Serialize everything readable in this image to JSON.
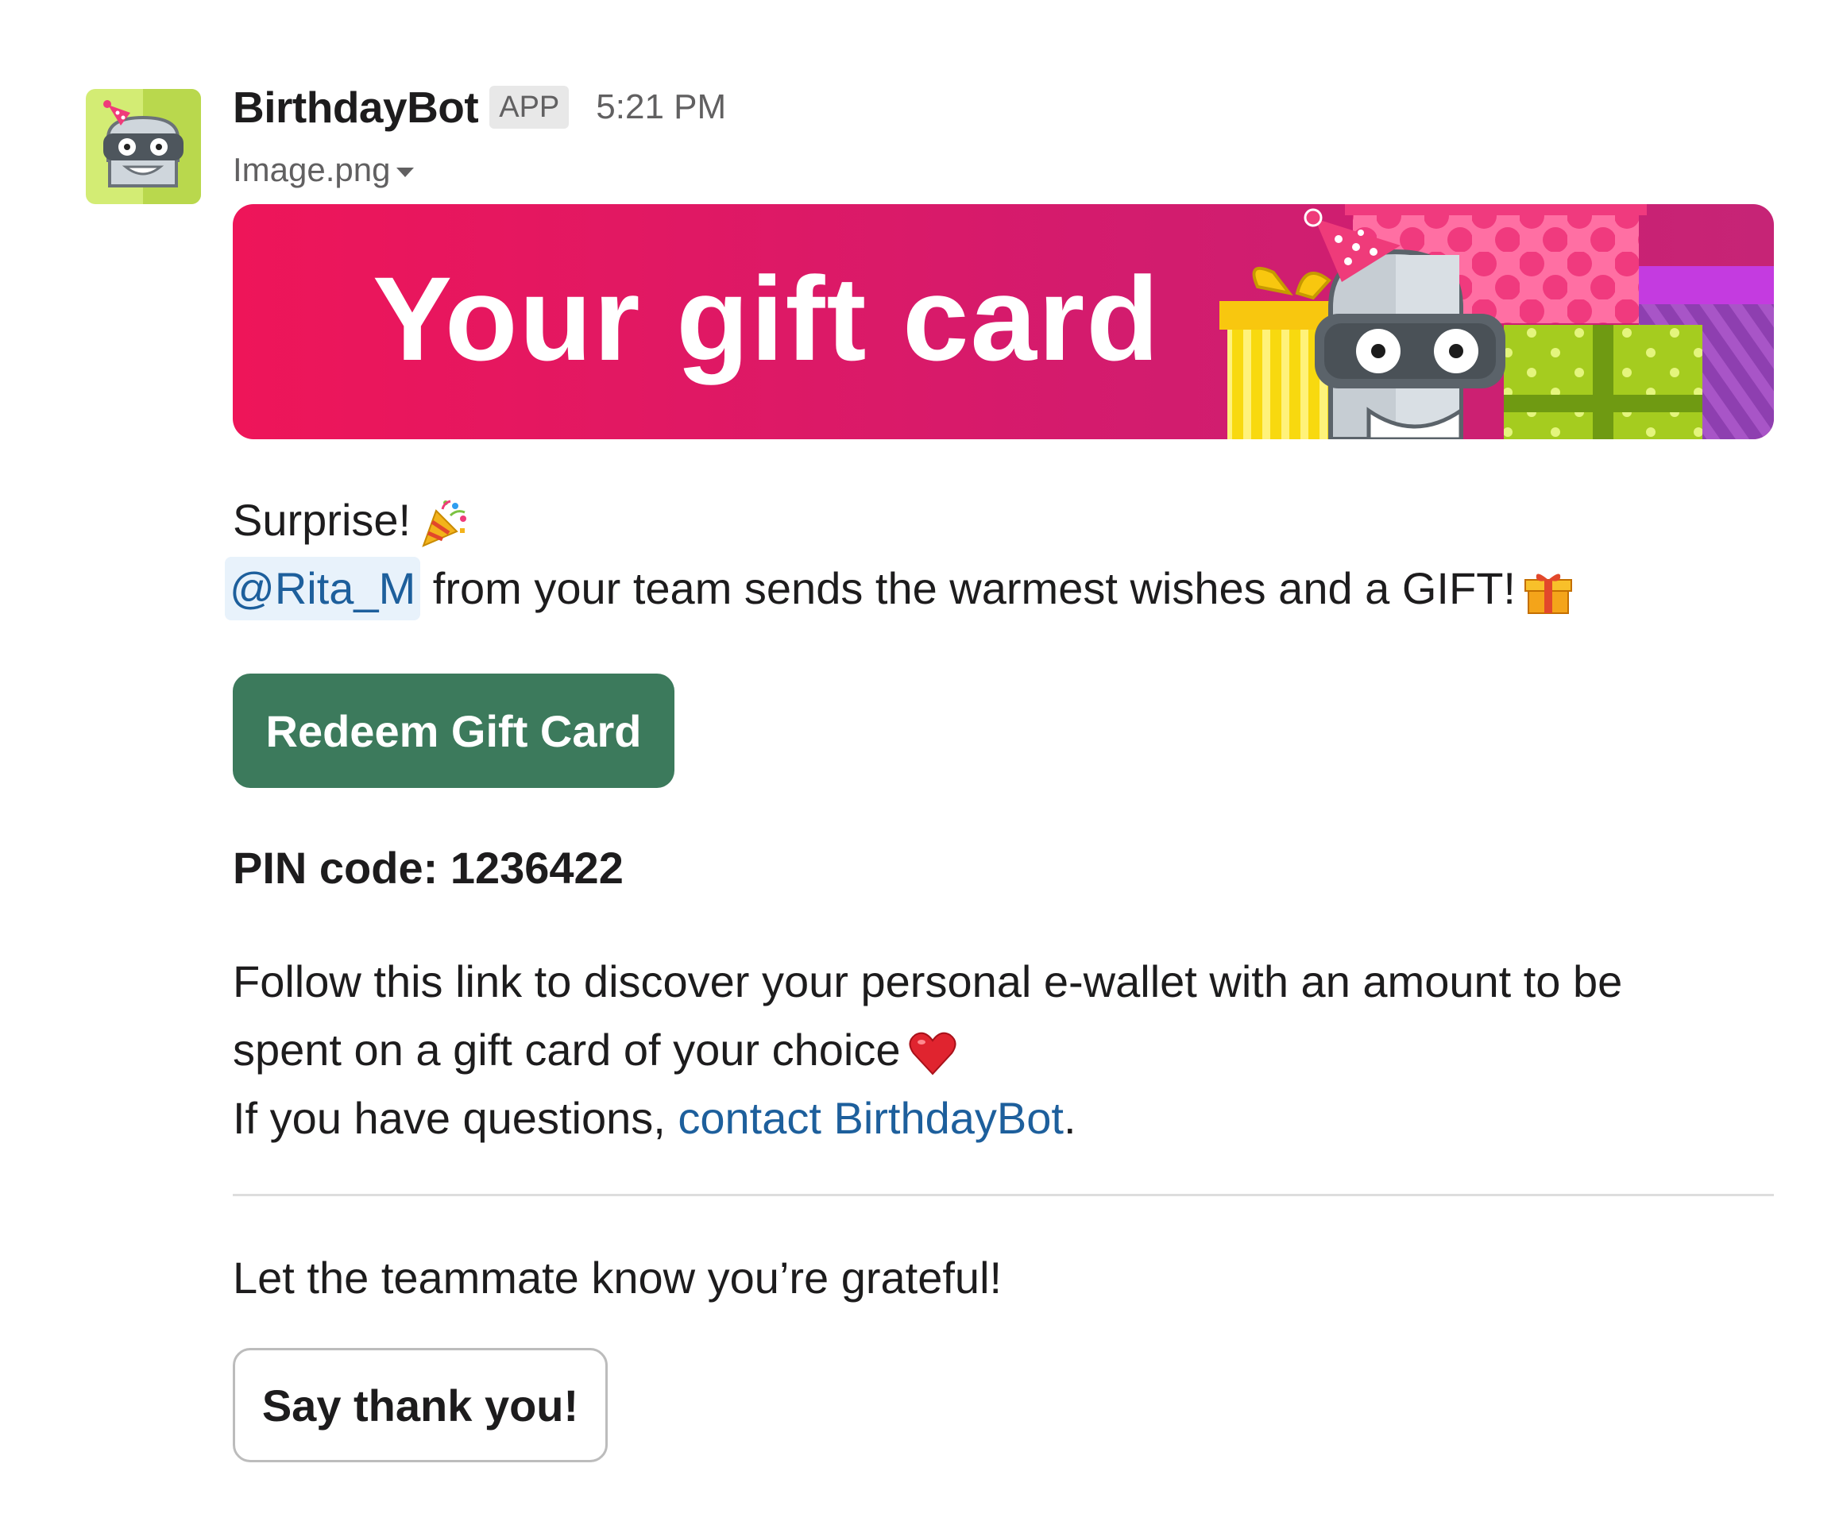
{
  "message": {
    "sender": "BirthdayBot",
    "badge": "APP",
    "time": "5:21 PM",
    "attachment_name": "Image.png"
  },
  "banner": {
    "title": "Your gift card",
    "colors": {
      "pink_start": "#ee1559",
      "pink_end": "#c91f73",
      "purple": "#8e3fb0",
      "lime": "#a5cc1f",
      "yellow": "#f8d90f",
      "gift_pink": "#ff6fa3"
    }
  },
  "content": {
    "surprise": "Surprise!",
    "mention": "@Rita_M",
    "wishes": "from your team sends the warmest wishes and a GIFT!",
    "redeem_label": "Redeem Gift Card",
    "pin_label": "PIN code:",
    "pin_value": "1236422",
    "para_line1": "Follow this link to discover your personal e-wallet with an amount to be",
    "para_line2": "spent on a gift card of your choice",
    "questions_prefix": "If you have questions,",
    "contact_link": "contact BirthdayBot",
    "questions_suffix": ".",
    "grateful": "Let the teammate know you’re grateful!",
    "thanks_label": "Say thank you!"
  },
  "icons": {
    "avatar": "birthdaybot-robot-icon",
    "file_menu": "chevron-down-icon",
    "surprise_emoji": "party-popper-icon",
    "gift_emoji": "wrapped-gift-icon",
    "heart_emoji": "red-heart-icon"
  },
  "theme": {
    "accent_green": "#3c7a5c",
    "link_blue": "#1d5f9c",
    "mention_bg": "#e8f2fb",
    "text": "#1d1c1d",
    "muted": "#616061"
  }
}
